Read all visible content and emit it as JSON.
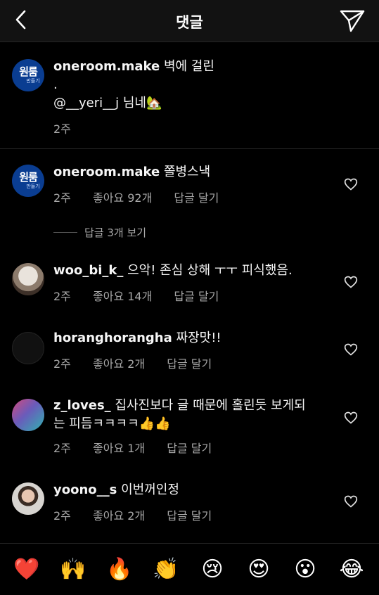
{
  "header": {
    "title": "댓글",
    "back_icon": "chevron-left-icon",
    "send_icon": "paper-plane-icon"
  },
  "caption": {
    "username": "oneroom.make",
    "text_line1": "벽에 걸린",
    "text_line2": ".",
    "text_line3": "@__yeri__j 님네🏡",
    "time": "2주",
    "avatar_text_big": "원룸",
    "avatar_text_small": "만들기"
  },
  "comments": [
    {
      "username": "oneroom.make",
      "text": "쫄병스낵",
      "time": "2주",
      "likes": "좋아요 92개",
      "reply": "답글 달기",
      "avatar_text_big": "원룸",
      "avatar_text_small": "만들기",
      "view_replies": "답글 3개 보기"
    },
    {
      "username": "woo_bi_k_",
      "text": "으악! 존심 상해 ㅜㅜ 피식했음.",
      "time": "2주",
      "likes": "좋아요 14개",
      "reply": "답글 달기"
    },
    {
      "username": "horanghorangha",
      "text": "짜장맛!!",
      "time": "2주",
      "likes": "좋아요 2개",
      "reply": "답글 달기"
    },
    {
      "username": "z_loves_",
      "text_line1": "집사진보다 글 때문에 홀린듯 보게되",
      "text_line2": "는 피듬ㅋㅋㅋㅋ👍👍",
      "time": "2주",
      "likes": "좋아요 1개",
      "reply": "답글 달기"
    },
    {
      "username": "yoono__s",
      "text": "이번꺼인정",
      "time": "2주",
      "likes": "좋아요 2개",
      "reply": "답글 달기"
    }
  ],
  "reactions": [
    "❤️",
    "🙌",
    "🔥",
    "👏",
    "😢",
    "😍",
    "😮",
    "😂"
  ],
  "colors": {
    "background": "#000000",
    "header_bg": "#121212",
    "secondary_text": "#a8a8a8",
    "brand_avatar": "#0a3d91"
  }
}
